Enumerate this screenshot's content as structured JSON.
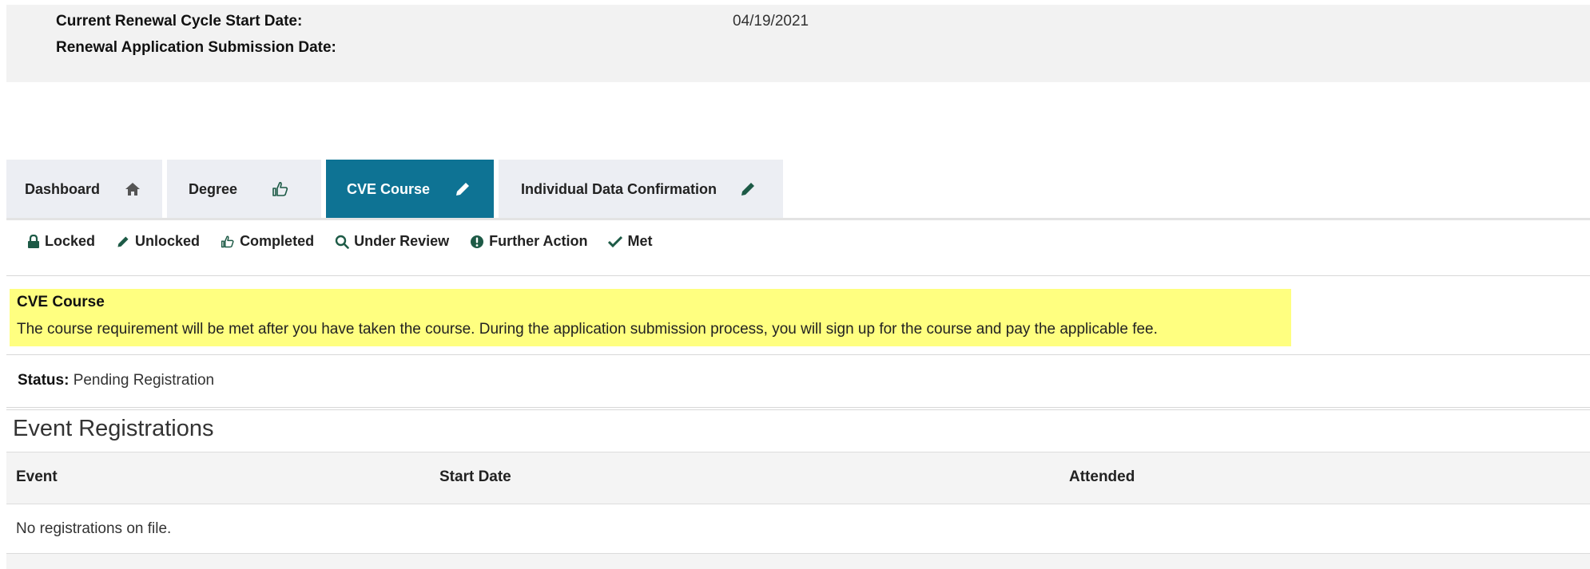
{
  "renewal": {
    "cycle_start_label": "Current Renewal Cycle Start Date:",
    "cycle_start_value": "04/19/2021",
    "submission_label": "Renewal Application Submission Date:",
    "submission_value": ""
  },
  "tabs": [
    {
      "label": "Dashboard",
      "icon": "home-icon",
      "active": false
    },
    {
      "label": "Degree",
      "icon": "thumbs-up-icon",
      "active": false
    },
    {
      "label": "CVE Course",
      "icon": "pencil-icon",
      "active": true
    },
    {
      "label": "Individual Data Confirmation",
      "icon": "pencil-icon",
      "active": false
    }
  ],
  "legend": [
    {
      "label": "Locked",
      "icon": "lock-icon"
    },
    {
      "label": "Unlocked",
      "icon": "pencil-icon"
    },
    {
      "label": "Completed",
      "icon": "thumbs-up-icon"
    },
    {
      "label": "Under Review",
      "icon": "search-icon"
    },
    {
      "label": "Further Action",
      "icon": "exclamation-icon"
    },
    {
      "label": "Met",
      "icon": "check-icon"
    }
  ],
  "notice": {
    "title": "CVE Course",
    "text": "The course requirement will be met after you have taken the course. During the application submission process, you will sign up for the course and pay the applicable fee."
  },
  "status": {
    "label": "Status:",
    "value": "Pending Registration"
  },
  "events": {
    "title": "Event Registrations",
    "columns": [
      "Event",
      "Start Date",
      "Attended"
    ],
    "empty_text": "No registrations on file."
  },
  "colors": {
    "active_tab": "#0e7394",
    "notice_bg": "#ffff80",
    "icon_green": "#1d5a46"
  }
}
